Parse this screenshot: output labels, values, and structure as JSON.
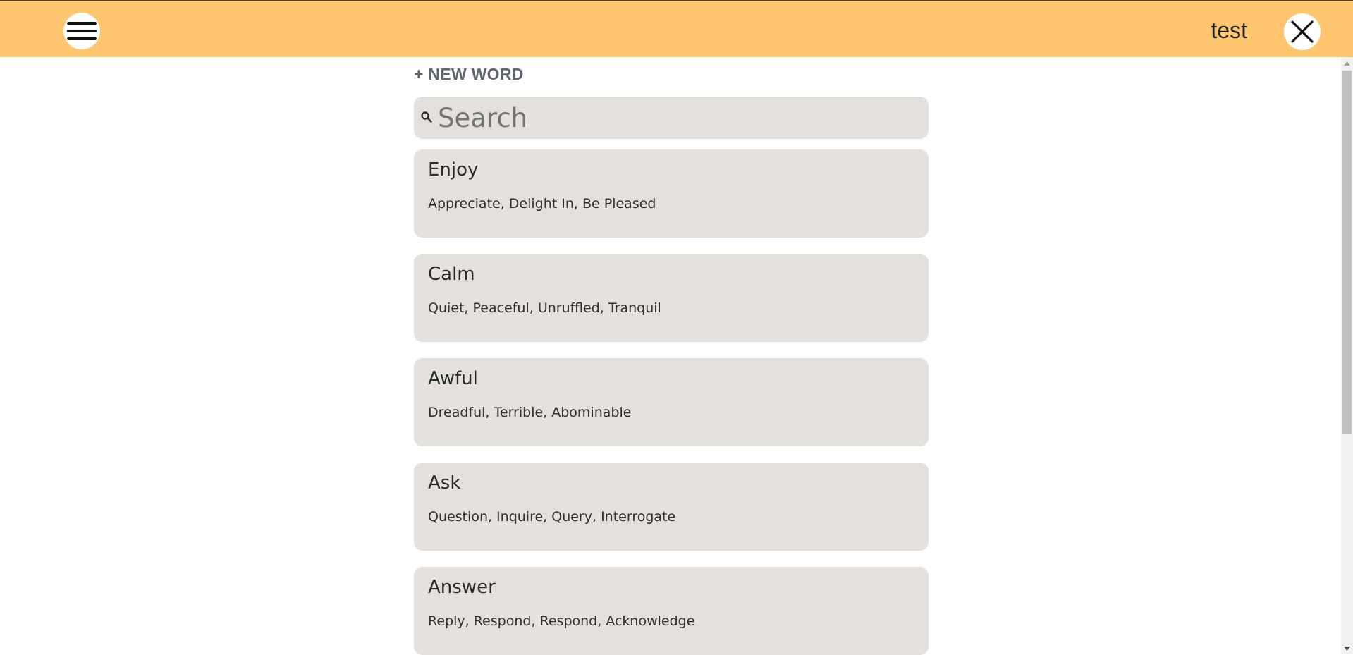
{
  "header": {
    "user_name": "test",
    "background_color": "#ffc56f",
    "menu_icon": "hamburger-menu-icon",
    "close_icon": "close-icon"
  },
  "toolbar": {
    "new_word_label": "+ NEW WORD"
  },
  "search": {
    "placeholder": "Search",
    "value": "",
    "icon": "search-icon"
  },
  "words": [
    {
      "word": "Enjoy",
      "synonyms": "Appreciate, Delight In, Be Pleased"
    },
    {
      "word": "Calm",
      "synonyms": "Quiet, Peaceful, Unruffled, Tranquil"
    },
    {
      "word": "Awful",
      "synonyms": "Dreadful, Terrible, Abominable"
    },
    {
      "word": "Ask",
      "synonyms": "Question, Inquire, Query, Interrogate"
    },
    {
      "word": "Answer",
      "synonyms": "Reply, Respond, Respond, Acknowledge"
    }
  ],
  "colors": {
    "card_background": "#e4e1dd",
    "new_word_text": "#5f6470"
  }
}
